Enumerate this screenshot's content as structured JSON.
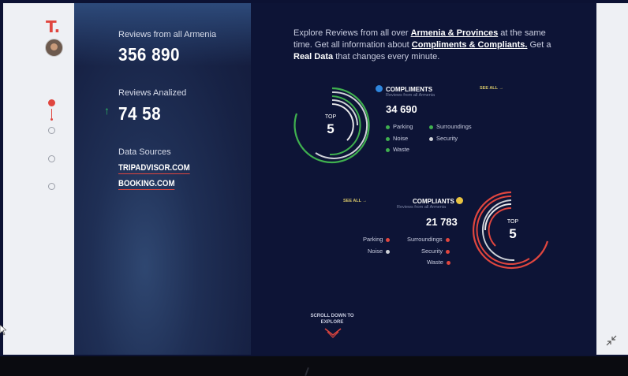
{
  "sidebar": {
    "logo": "T.",
    "steps": 4,
    "active_step": 1
  },
  "hero": {
    "reviews_all_label": "Reviews from all Armenia",
    "reviews_all_value": "356 890",
    "reviews_analyzed_label": "Reviews Analized",
    "reviews_analyzed_value": "74 58",
    "sources_label": "Data Sources",
    "sources": [
      "TRIPADVISOR.COM",
      "BOOKING.COM"
    ]
  },
  "intro": {
    "t1": "Explore Reviews from all over ",
    "link1": "Armenia & Provinces",
    "t2": " at the same time. Get all information about ",
    "link2": "Compliments & Compliants.",
    "t3": " Get a ",
    "bold1": "Real Data",
    "t4": " that changes every minute."
  },
  "compliments": {
    "title": "COMPLIMENTS",
    "subtitle": "Reviews from all Armenia",
    "count": "34 690",
    "see_all": "SEE ALL",
    "top_label": "TOP",
    "top_num": "5",
    "accent": "#3fb04f",
    "items": [
      "Parking",
      "Surroundings",
      "Noise",
      "Security",
      "Waste"
    ]
  },
  "compliants": {
    "title": "COMPLIANTS",
    "subtitle": "Reviews from all Armenia",
    "count": "21 783",
    "see_all": "SEE ALL",
    "top_label": "TOP",
    "top_num": "5",
    "accent": "#e0463f",
    "items": [
      "Parking",
      "Surroundings",
      "Noise",
      "Security",
      "Waste"
    ]
  },
  "scroll": {
    "line1": "SCROLL DOWN TO",
    "line2": "EXPLORE"
  },
  "icons": [
    "avatar",
    "up-arrow-icon",
    "smile-icon",
    "frown-icon",
    "arrow-right-icon",
    "chevron-down-icon",
    "collapse-icon",
    "cursor-icon"
  ]
}
